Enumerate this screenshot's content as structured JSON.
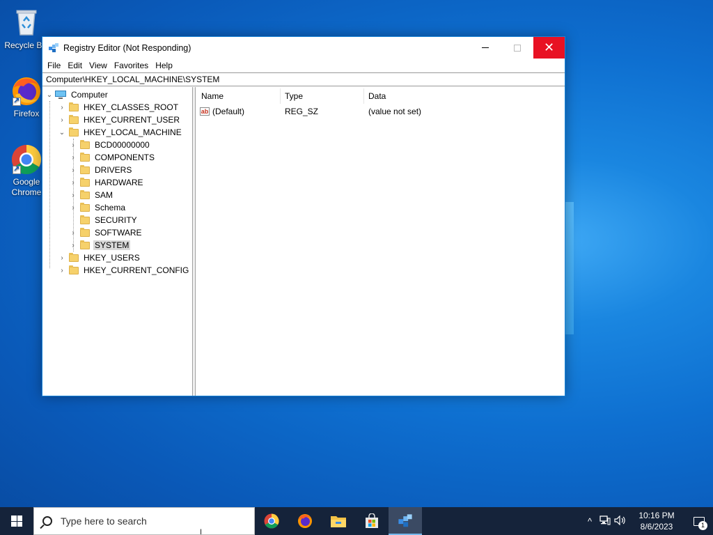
{
  "desktop": {
    "icons": [
      {
        "label": "Recycle Bin",
        "icon": "recycle-bin-icon"
      },
      {
        "label": "Firefox",
        "icon": "firefox-icon"
      },
      {
        "label": "Google Chrome",
        "icon": "chrome-icon"
      }
    ]
  },
  "window": {
    "title": "Registry Editor (Not Responding)",
    "icon": "registry-editor-icon",
    "controls": {
      "minimize": "minimize",
      "maximize": "maximize",
      "close": "✕"
    },
    "menu": [
      "File",
      "Edit",
      "View",
      "Favorites",
      "Help"
    ],
    "address": "Computer\\HKEY_LOCAL_MACHINE\\SYSTEM",
    "tree": {
      "root": "Computer",
      "hives": [
        {
          "label": "HKEY_CLASSES_ROOT",
          "expanded": false
        },
        {
          "label": "HKEY_CURRENT_USER",
          "expanded": false
        },
        {
          "label": "HKEY_LOCAL_MACHINE",
          "expanded": true,
          "children": [
            "BCD00000000",
            "COMPONENTS",
            "DRIVERS",
            "HARDWARE",
            "SAM",
            "Schema",
            "SECURITY",
            "SOFTWARE",
            "SYSTEM"
          ]
        },
        {
          "label": "HKEY_USERS",
          "expanded": false
        },
        {
          "label": "HKEY_CURRENT_CONFIG",
          "expanded": false
        }
      ],
      "selected": "SYSTEM"
    },
    "list": {
      "columns": [
        "Name",
        "Type",
        "Data"
      ],
      "rows": [
        {
          "name": "(Default)",
          "type": "REG_SZ",
          "data": "(value not set)"
        }
      ]
    }
  },
  "taskbar": {
    "search_placeholder": "Type here to search",
    "apps": [
      "chrome-icon",
      "firefox-icon",
      "file-explorer-icon",
      "microsoft-store-icon",
      "registry-editor-icon"
    ],
    "active_app": "registry-editor-icon",
    "tray": {
      "chevron": "^",
      "time": "10:16 PM",
      "date": "8/6/2023",
      "notifications": "1"
    }
  },
  "colors": {
    "close_button": "#e81123",
    "taskbar": "#15233a",
    "folder": "#f6d16b",
    "window_border": "#1883d7"
  }
}
